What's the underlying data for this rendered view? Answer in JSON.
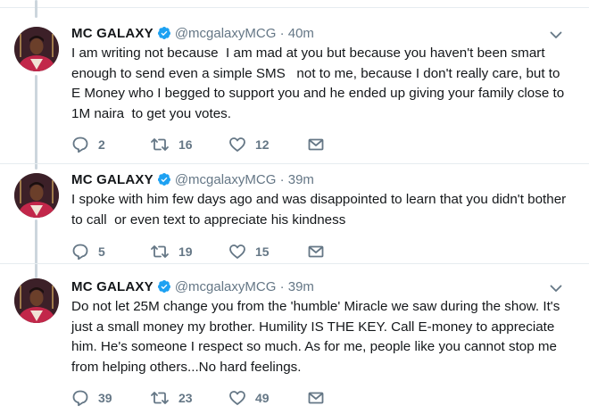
{
  "tweets": [
    {
      "name": "MC GALAXY",
      "handle": "@mcgalaxyMCG",
      "separator": "·",
      "time": "40m",
      "text": "I am writing not because  I am mad at you but because you haven't been smart enough to send even a simple SMS   not to me, because I don't really care, but to E Money who I begged to support you and he ended up giving your family close to 1M naira  to get you votes.",
      "replies": "2",
      "retweets": "16",
      "likes": "12"
    },
    {
      "name": "MC GALAXY",
      "handle": "@mcgalaxyMCG",
      "separator": "·",
      "time": "39m",
      "text": "I spoke with him few days ago and was disappointed to learn that you didn't bother to call  or even text to appreciate his kindness",
      "replies": "5",
      "retweets": "19",
      "likes": "15"
    },
    {
      "name": "MC GALAXY",
      "handle": "@mcgalaxyMCG",
      "separator": "·",
      "time": "39m",
      "text": "Do not let 25M change you from the 'humble' Miracle we saw during the show. It's just a small money my brother. Humility IS THE KEY. Call E-money to appreciate him. He's someone I respect so much. As for me, people like you cannot stop me from helping others...No hard feelings.",
      "replies": "39",
      "retweets": "23",
      "likes": "49"
    }
  ],
  "icons": {
    "reply": "reply-icon",
    "retweet": "retweet-icon",
    "like": "heart-icon",
    "dm": "envelope-icon",
    "verified": "verified-badge-icon",
    "more": "chevron-down-icon"
  },
  "colors": {
    "text": "#14171a",
    "secondary": "#657786",
    "verified": "#1da1f2",
    "thread_line": "#ccd6dd",
    "divider": "#e6ecf0"
  }
}
